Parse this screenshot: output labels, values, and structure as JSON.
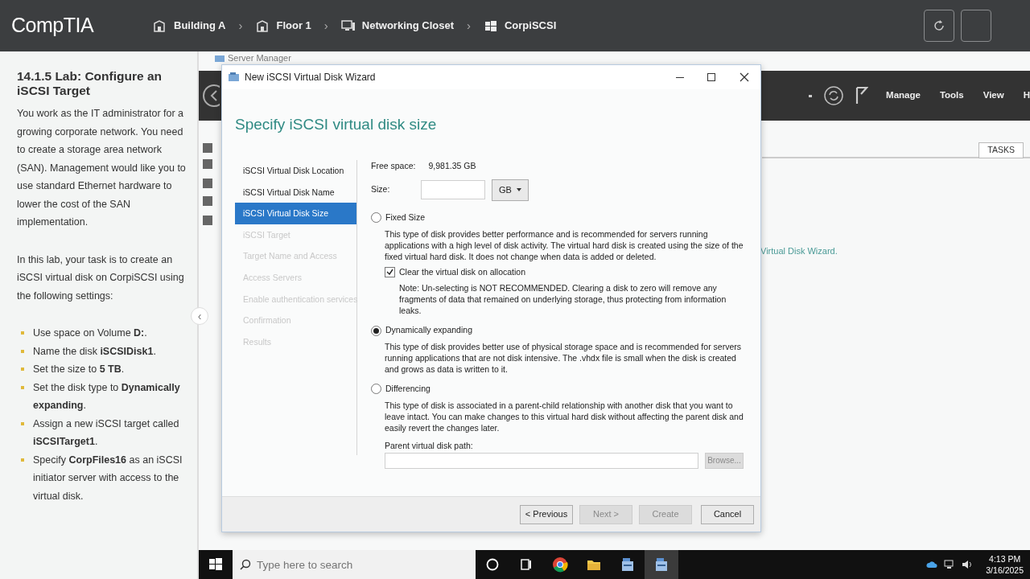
{
  "top_bar": {
    "logo": "CompTIA",
    "breadcrumbs": [
      {
        "label": "Building A",
        "kind": "building"
      },
      {
        "label": "Floor 1",
        "kind": "building"
      },
      {
        "label": "Networking Closet",
        "kind": "closet"
      },
      {
        "label": "CorpiSCSI",
        "kind": "windows"
      }
    ],
    "separator": "›"
  },
  "lab_panel": {
    "title": "14.1.5 Lab: Configure an iSCSI Target",
    "paragraphs": [
      "You work as the IT administrator for a growing corporate network. You need to create a storage area network (SAN). Management would like you to use standard Ethernet hardware to lower the cost of the SAN implementation.",
      "In this lab, your task is to create an iSCSI virtual disk on CorpiSCSI using the following settings:"
    ],
    "tasks": [
      "Use space on Volume **D:**.",
      "Name the disk **iSCSIDisk1**.",
      "Set the size to **5 TB**.",
      "Set the disk type to **Dynamically expanding**.",
      "Assign a new iSCSI target called **iSCSITarget1**.",
      "Specify **CorpFiles16** as an iSCSI initiator server with access to the virtual disk."
    ],
    "collapse_handle": "‹"
  },
  "server_manager": {
    "title": "Server Manager",
    "menu": [
      "Manage",
      "Tools",
      "View",
      "H"
    ],
    "tasks_button": "TASKS",
    "link_text": "Virtual Disk Wizard."
  },
  "wizard": {
    "title": "New iSCSI Virtual Disk Wizard",
    "heading": "Specify iSCSI virtual disk size",
    "steps": [
      {
        "label": "iSCSI Virtual Disk Location",
        "selected": false,
        "disabled": false
      },
      {
        "label": "iSCSI Virtual Disk Name",
        "selected": false,
        "disabled": false
      },
      {
        "label": "iSCSI Virtual Disk Size",
        "selected": true,
        "disabled": false
      },
      {
        "label": "iSCSI Target",
        "selected": false,
        "disabled": true
      },
      {
        "label": "Target Name and Access",
        "selected": false,
        "disabled": true
      },
      {
        "label": "Access Servers",
        "selected": false,
        "disabled": true
      },
      {
        "label": "Enable authentication services",
        "selected": false,
        "disabled": true
      },
      {
        "label": "Confirmation",
        "selected": false,
        "disabled": true
      },
      {
        "label": "Results",
        "selected": false,
        "disabled": true
      }
    ],
    "free_space_label": "Free space:",
    "free_space": "9,981.35 GB",
    "size_label": "Size:",
    "unit": "GB",
    "options": [
      {
        "label": "Fixed Size",
        "selected": false,
        "description": "This type of disk provides better performance and is recommended for servers running applications with a high level of disk activity. The virtual hard disk is created using the size of the fixed virtual hard disk. It does not change when data is added or deleted.",
        "checkbox": {
          "label": "Clear the virtual disk on allocation",
          "checked": true,
          "note": "Note: Un-selecting is NOT RECOMMENDED. Clearing a disk to zero will remove any fragments of data that remained on underlying storage, thus protecting from information leaks."
        }
      },
      {
        "label": "Dynamically expanding",
        "selected": true,
        "description": "This type of disk provides better use of physical storage space and is recommended for servers running applications that are not disk intensive. The .vhdx file is small when the disk is created and grows as data is written to it."
      },
      {
        "label": "Differencing",
        "selected": false,
        "description": "This type of disk is associated in a parent-child relationship with another disk that you want to leave intact. You can make changes to this virtual hard disk without affecting the parent disk and easily revert the changes later.",
        "path": {
          "label": "Parent virtual disk path:",
          "browse": "Browse...",
          "disabled": true
        }
      }
    ],
    "buttons": [
      {
        "label": "< Previous",
        "disabled": false
      },
      {
        "label": "Next >",
        "disabled": true
      },
      {
        "label": "Create",
        "disabled": true
      },
      {
        "label": "Cancel",
        "disabled": false
      }
    ]
  },
  "taskbar": {
    "search_placeholder": "Type here to search",
    "apps": [
      {
        "kind": "cortana",
        "selected": false
      },
      {
        "kind": "taskview",
        "selected": false
      },
      {
        "kind": "chrome",
        "selected": false
      },
      {
        "kind": "folder",
        "selected": false
      },
      {
        "kind": "server",
        "selected": false
      },
      {
        "kind": "server",
        "selected": true
      }
    ],
    "time": "4:13 PM",
    "date": "3/16/2025"
  }
}
